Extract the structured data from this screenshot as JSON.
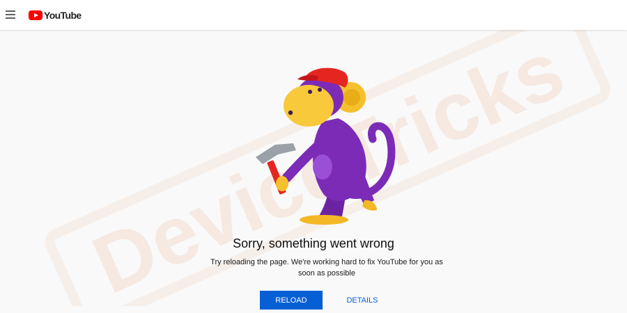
{
  "header": {
    "logo_text": "YouTube",
    "menu_icon": "hamburger-menu-icon"
  },
  "watermark": {
    "text": "DeviceTricks"
  },
  "error": {
    "title": "Sorry, something went wrong",
    "description": "Try reloading the page. We're working hard to fix YouTube for you as soon as possible"
  },
  "actions": {
    "reload_label": "RELOAD",
    "details_label": "DETAILS"
  },
  "colors": {
    "brand_red": "#ff0000",
    "accent_blue": "#065fd4",
    "monkey_purple": "#7c2bb7",
    "monkey_face": "#f9c93c",
    "cap_red": "#e52620",
    "watermark": "#f3e2d6"
  }
}
